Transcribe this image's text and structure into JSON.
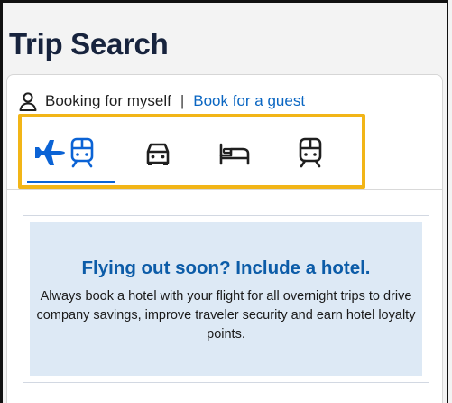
{
  "page": {
    "title": "Trip Search"
  },
  "booking": {
    "self_label": "Booking for myself",
    "separator": "|",
    "guest_link": "Book for a guest"
  },
  "tabs": [
    {
      "name": "flight-and-train",
      "icons": [
        "airplane-icon",
        "train-icon"
      ],
      "active": true
    },
    {
      "name": "car",
      "icons": [
        "car-icon"
      ],
      "active": false
    },
    {
      "name": "hotel",
      "icons": [
        "bed-icon"
      ],
      "active": false
    },
    {
      "name": "rail",
      "icons": [
        "train-icon"
      ],
      "active": false
    }
  ],
  "promo": {
    "heading": "Flying out soon? Include a hotel.",
    "body": "Always book a hotel with your flight for all overnight trips to drive company savings, improve traveler security and earn hotel loyalty points."
  },
  "colors": {
    "accent": "#0b63d5",
    "highlight_border": "#f2b517",
    "promo_background": "#dde9f5",
    "promo_heading": "#0c5ca8",
    "title": "#17233d"
  }
}
